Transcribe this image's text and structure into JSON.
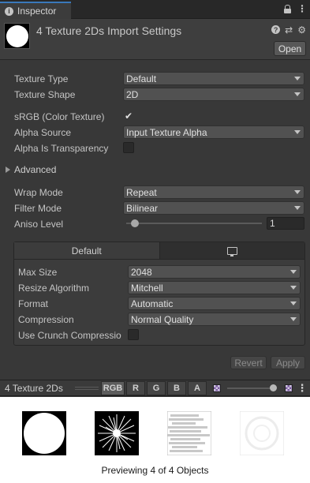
{
  "window": {
    "tab_label": "Inspector",
    "tab_icon": "info-icon"
  },
  "header": {
    "title": "4 Texture 2Ds Import Settings",
    "open_label": "Open"
  },
  "settings": {
    "texture_type": {
      "label": "Texture Type",
      "value": "Default"
    },
    "texture_shape": {
      "label": "Texture Shape",
      "value": "2D"
    },
    "srgb": {
      "label": "sRGB (Color Texture)",
      "checked": true
    },
    "alpha_source": {
      "label": "Alpha Source",
      "value": "Input Texture Alpha"
    },
    "alpha_transparency": {
      "label": "Alpha Is Transparency",
      "checked": false
    },
    "advanced_label": "Advanced",
    "wrap_mode": {
      "label": "Wrap Mode",
      "value": "Repeat"
    },
    "filter_mode": {
      "label": "Filter Mode",
      "value": "Bilinear"
    },
    "aniso_level": {
      "label": "Aniso Level",
      "value": "1"
    }
  },
  "platform": {
    "tabs": [
      "Default"
    ],
    "max_size": {
      "label": "Max Size",
      "value": "2048"
    },
    "resize_algorithm": {
      "label": "Resize Algorithm",
      "value": "Mitchell"
    },
    "format": {
      "label": "Format",
      "value": "Automatic"
    },
    "compression": {
      "label": "Compression",
      "value": "Normal Quality"
    },
    "crunch": {
      "label": "Use Crunch Compressio",
      "checked": false
    }
  },
  "actions": {
    "revert_label": "Revert",
    "apply_label": "Apply"
  },
  "preview": {
    "title": "4 Texture 2Ds",
    "channels": [
      "RGB",
      "R",
      "G",
      "B",
      "A"
    ],
    "selected_channel": "RGB",
    "caption": "Previewing 4 of 4 Objects"
  }
}
